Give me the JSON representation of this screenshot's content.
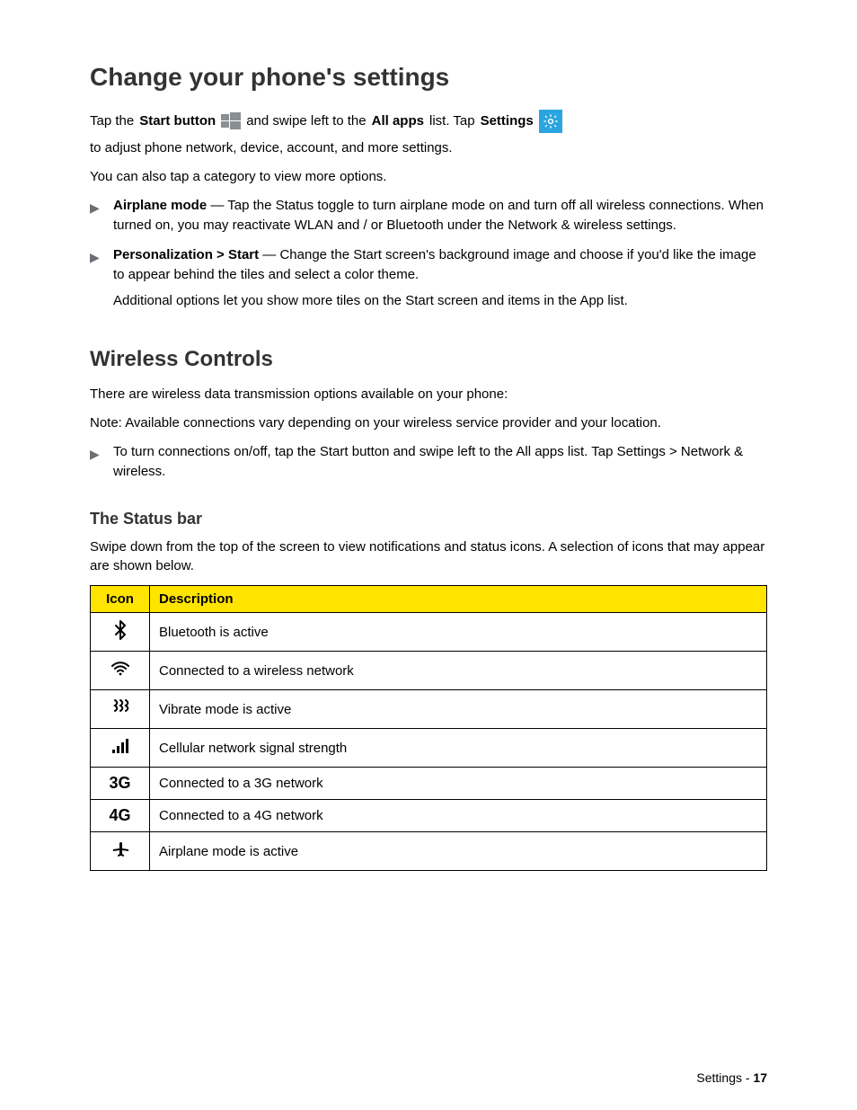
{
  "headings": {
    "settings": "Change your phone's settings",
    "wireless": "Wireless Controls",
    "statusbar": "The Status bar"
  },
  "settings_intro_pre": "Tap the",
  "settings_intro_mid": "Start button",
  "settings_intro_post1": "and swipe left to the",
  "settings_intro_allapps": "All apps",
  "settings_intro_post2": "list. Tap",
  "settings_intro_settingsword": "Settings",
  "settings_intro_tail": "to adjust phone network, device, account, and more settings.",
  "settings_intro_second": "You can also tap a category to view more options.",
  "bullets": {
    "airplane": {
      "title": "Airplane mode",
      "body": " — Tap the Status toggle to turn airplane mode on and turn off all wireless connections. When turned on, you may reactivate WLAN and / or Bluetooth under the Network & wireless settings."
    },
    "personalization": {
      "title": "Personalization > Start",
      "body": " — Change the Start screen's background image and choose if you'd like the image to appear behind the tiles and select a color theme.",
      "sub": "Additional options let you show more tiles on the Start screen and items in the App list."
    }
  },
  "wireless_intro": "There are wireless data transmission options available on your phone:",
  "wireless_note": "Note: Available connections vary depending on your wireless service provider and your location.",
  "wireless_bullet": "To turn connections on/off, tap the Start button and swipe left to the All apps list. Tap Settings > Network & wireless.",
  "status_intro": "Swipe down from the top of the screen to view notifications and status icons. A selection of icons that may appear are shown below.",
  "table": {
    "headers": {
      "icon": "Icon",
      "desc": "Description"
    },
    "rows": [
      {
        "icon": "bluetooth",
        "desc": "Bluetooth is active"
      },
      {
        "icon": "wifi",
        "desc": "Connected to a wireless network"
      },
      {
        "icon": "vibrate",
        "desc": "Vibrate mode is active"
      },
      {
        "icon": "signal",
        "desc": "Cellular network signal strength"
      },
      {
        "icon": "3g",
        "desc": "Connected to a 3G network"
      },
      {
        "icon": "4g",
        "desc": "Connected to a 4G network"
      },
      {
        "icon": "airplane",
        "desc": "Airplane mode is active"
      }
    ]
  },
  "page_number_prefix": "Settings -",
  "page_number": "17"
}
